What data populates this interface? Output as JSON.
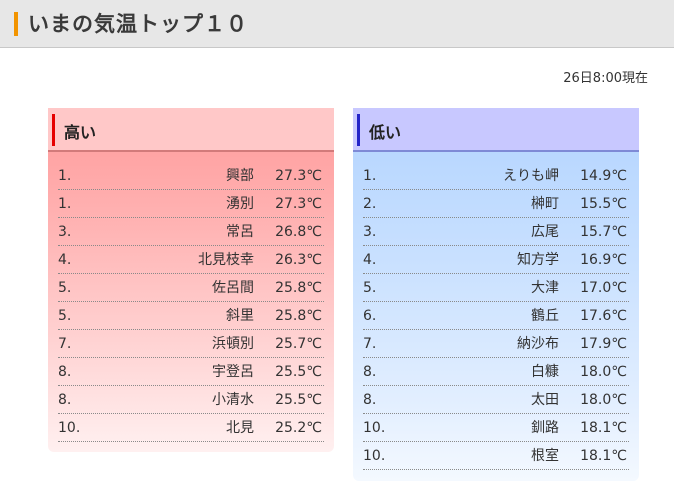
{
  "header": {
    "title": "いまの気温トップ１０"
  },
  "timestamp": "26日8:00現在",
  "colors": {
    "header_accent": "#f29400",
    "high_accent": "#e60000",
    "low_accent": "#2424c8"
  },
  "high": {
    "label": "高い",
    "rows": [
      {
        "rank": "1.",
        "city": "興部",
        "temp": "27.3℃"
      },
      {
        "rank": "1.",
        "city": "湧別",
        "temp": "27.3℃"
      },
      {
        "rank": "3.",
        "city": "常呂",
        "temp": "26.8℃"
      },
      {
        "rank": "4.",
        "city": "北見枝幸",
        "temp": "26.3℃"
      },
      {
        "rank": "5.",
        "city": "佐呂間",
        "temp": "25.8℃"
      },
      {
        "rank": "5.",
        "city": "斜里",
        "temp": "25.8℃"
      },
      {
        "rank": "7.",
        "city": "浜頓別",
        "temp": "25.7℃"
      },
      {
        "rank": "8.",
        "city": "宇登呂",
        "temp": "25.5℃"
      },
      {
        "rank": "8.",
        "city": "小清水",
        "temp": "25.5℃"
      },
      {
        "rank": "10.",
        "city": "北見",
        "temp": "25.2℃"
      }
    ]
  },
  "low": {
    "label": "低い",
    "rows": [
      {
        "rank": "1.",
        "city": "えりも岬",
        "temp": "14.9℃"
      },
      {
        "rank": "2.",
        "city": "榊町",
        "temp": "15.5℃"
      },
      {
        "rank": "3.",
        "city": "広尾",
        "temp": "15.7℃"
      },
      {
        "rank": "4.",
        "city": "知方学",
        "temp": "16.9℃"
      },
      {
        "rank": "5.",
        "city": "大津",
        "temp": "17.0℃"
      },
      {
        "rank": "6.",
        "city": "鶴丘",
        "temp": "17.6℃"
      },
      {
        "rank": "7.",
        "city": "納沙布",
        "temp": "17.9℃"
      },
      {
        "rank": "8.",
        "city": "白糠",
        "temp": "18.0℃"
      },
      {
        "rank": "8.",
        "city": "太田",
        "temp": "18.0℃"
      },
      {
        "rank": "10.",
        "city": "釧路",
        "temp": "18.1℃"
      },
      {
        "rank": "10.",
        "city": "根室",
        "temp": "18.1℃"
      }
    ]
  }
}
